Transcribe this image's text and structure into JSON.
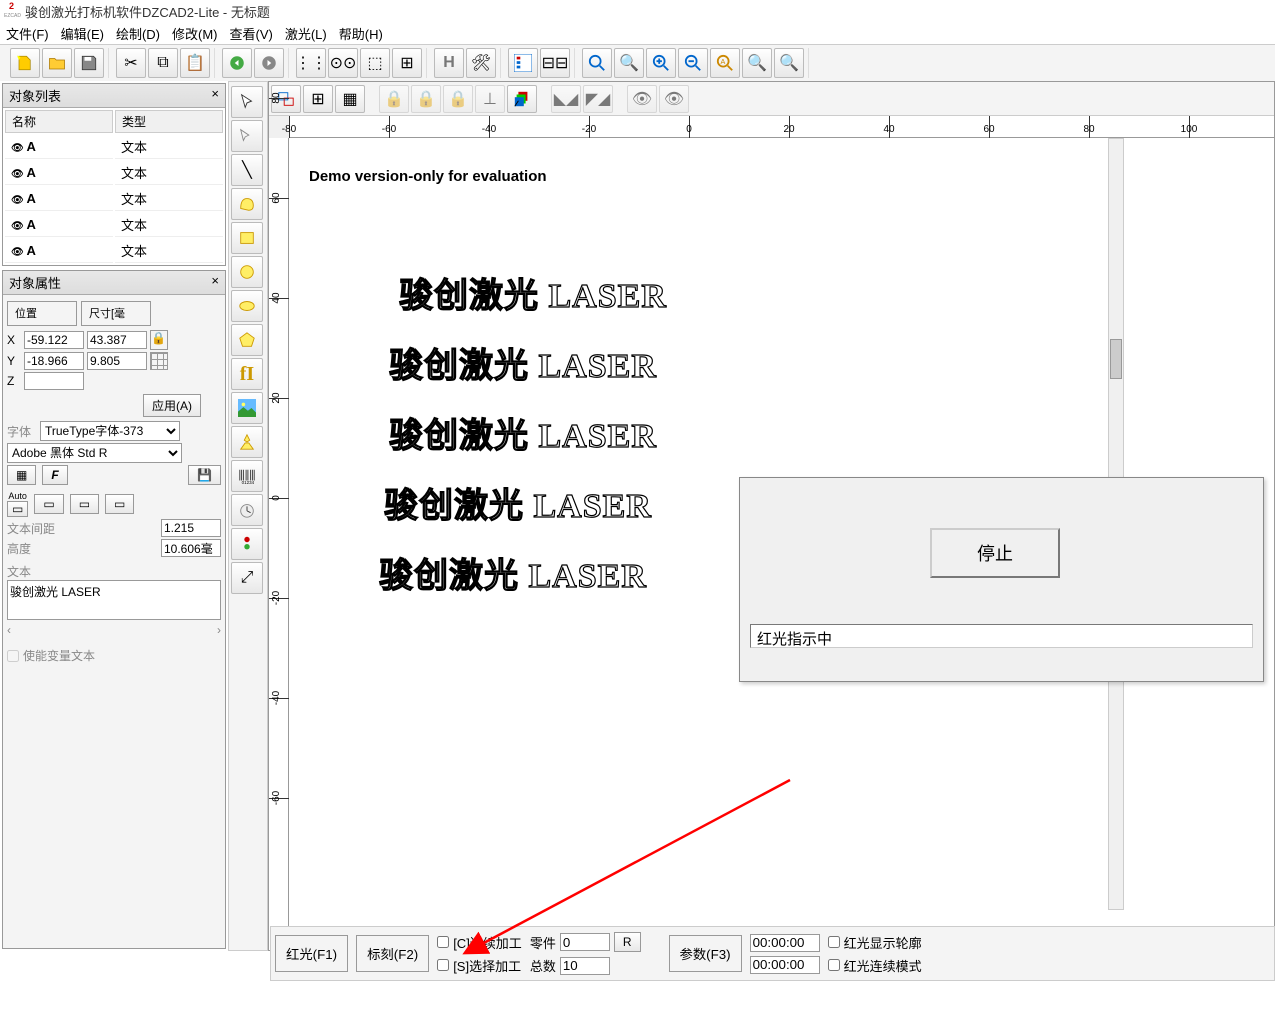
{
  "title": "骏创激光打标机软件DZCAD2-Lite  - 无标题",
  "menu": [
    "文件(F)",
    "编辑(E)",
    "绘制(D)",
    "修改(M)",
    "查看(V)",
    "激光(L)",
    "帮助(H)"
  ],
  "object_list": {
    "title": "对象列表",
    "cols": [
      "名称",
      "类型"
    ],
    "rows": [
      {
        "name": "A",
        "type": "文本"
      },
      {
        "name": "A",
        "type": "文本"
      },
      {
        "name": "A",
        "type": "文本"
      },
      {
        "name": "A",
        "type": "文本"
      },
      {
        "name": "A",
        "type": "文本"
      }
    ]
  },
  "object_props": {
    "title": "对象属性",
    "pos_label": "位置",
    "size_label": "尺寸[毫",
    "x": "-59.122",
    "w": "43.387",
    "y": "-18.966",
    "h": "9.805",
    "z": "",
    "apply": "应用(A)",
    "font_label": "字体",
    "font_sel": "TrueType字体-373",
    "font_family": "Adobe 黑体 Std R",
    "auto_label": "Auto",
    "spacing_label": "文本间距",
    "spacing": "1.215",
    "height_label": "高度",
    "height": "10.606毫",
    "text_label": "文本",
    "text_value": "骏创激光 LASER",
    "enable_var": "使能变量文本"
  },
  "canvas": {
    "demo": "Demo version-only for evaluation",
    "laser_lines": [
      "骏创激光 LASER",
      "骏创激光 LASER",
      "骏创激光 LASER",
      "骏创激光 LASER",
      "骏创激光 LASER"
    ],
    "ruler_h": [
      -80,
      -60,
      -40,
      -20,
      0,
      20,
      40,
      60,
      80,
      100
    ],
    "ruler_v": [
      -60,
      -40,
      -20,
      0,
      20,
      40,
      60,
      80
    ]
  },
  "dialog": {
    "stop": "停止",
    "status": "红光指示中"
  },
  "bottom": {
    "red_light": "红光(F1)",
    "mark": "标刻(F2)",
    "cont_proc": "[C]连续加工",
    "sel_proc": "[S]选择加工",
    "parts_label": "零件",
    "parts": "0",
    "r": "R",
    "total_label": "总数",
    "total": "10",
    "params": "参数(F3)",
    "time1": "00:00:00",
    "time2": "00:00:00",
    "red_show": "红光显示轮廓",
    "red_cont": "红光连续模式"
  }
}
